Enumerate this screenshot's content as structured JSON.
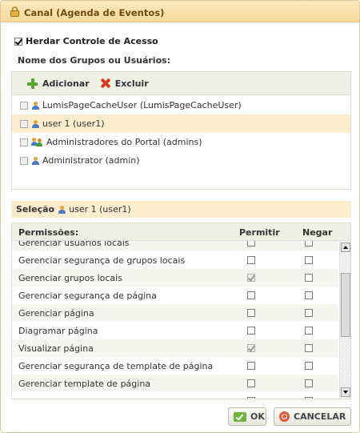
{
  "dialog": {
    "title": "Canal (Agenda de Eventos)",
    "inherit_label": "Herdar Controle de Acesso",
    "inherit_checked": true,
    "groups_label": "Nome dos Grupos ou Usuários:"
  },
  "toolbar": {
    "add_label": "Adicionar",
    "delete_label": "Excluir"
  },
  "groups": [
    {
      "label": "LumisPageCacheUser (LumisPageCacheUser)",
      "icon": "user-icon",
      "selected": false
    },
    {
      "label": "user 1 (user1)",
      "icon": "user-icon",
      "selected": true
    },
    {
      "label": "Administradores do Portal (admins)",
      "icon": "group-icon",
      "selected": false
    },
    {
      "label": "Administrator (admin)",
      "icon": "user-icon",
      "selected": false
    }
  ],
  "selection": {
    "label": "Seleção",
    "value": "user 1 (user1)"
  },
  "permissions_table": {
    "header_permissions": "Permissões:",
    "header_allow": "Permitir",
    "header_deny": "Negar",
    "rows": [
      {
        "name": "Gerenciar usuários locais",
        "allow": false,
        "deny": false
      },
      {
        "name": "Gerenciar segurança de grupos locais",
        "allow": false,
        "deny": false
      },
      {
        "name": "Gerenciar grupos locais",
        "allow": true,
        "deny": false
      },
      {
        "name": "Gerenciar segurança de página",
        "allow": false,
        "deny": false
      },
      {
        "name": "Gerenciar página",
        "allow": false,
        "deny": false
      },
      {
        "name": "Diagramar página",
        "allow": false,
        "deny": false
      },
      {
        "name": "Visualizar página",
        "allow": true,
        "deny": false
      },
      {
        "name": "Gerenciar segurança de template de página",
        "allow": false,
        "deny": false
      },
      {
        "name": "Gerenciar template de página",
        "allow": false,
        "deny": false
      },
      {
        "name": "",
        "allow": false,
        "deny": false
      }
    ]
  },
  "buttons": {
    "ok_label": "OK",
    "cancel_label": "CANCELAR"
  },
  "colors": {
    "title_bar": "#f8d99a",
    "selected_row": "#fdeccd",
    "toolbar_bg": "#eef0e3"
  }
}
